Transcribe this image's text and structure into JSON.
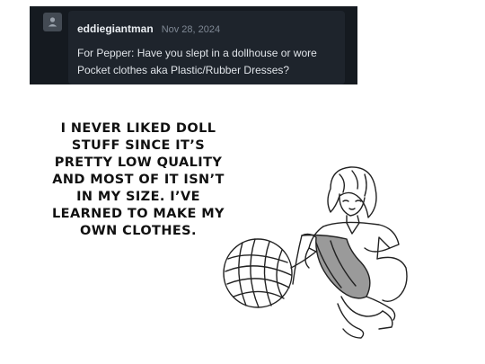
{
  "comment": {
    "username": "eddiegiantman",
    "date": "Nov 28, 2024",
    "text_lines": [
      "For Pepper: Have you slept in a dollhouse or wore",
      "Pocket clothes aka Plastic/Rubber Dresses?"
    ],
    "avatar_icon": "user-icon"
  },
  "speech_lines": [
    "I NEVER LIKED DOLL",
    "STUFF SINCE IT’S",
    "PRETTY LOW QUALITY",
    "AND MOST OF IT ISN’T",
    "IN MY SIZE. I’VE",
    "LEARNED TO MAKE MY",
    "OWN CLOTHES."
  ],
  "colors": {
    "panel": "#151a20",
    "card": "#1e242c",
    "username": "#e9edf1",
    "date": "#7f8894",
    "body": "#dfe3e8"
  }
}
